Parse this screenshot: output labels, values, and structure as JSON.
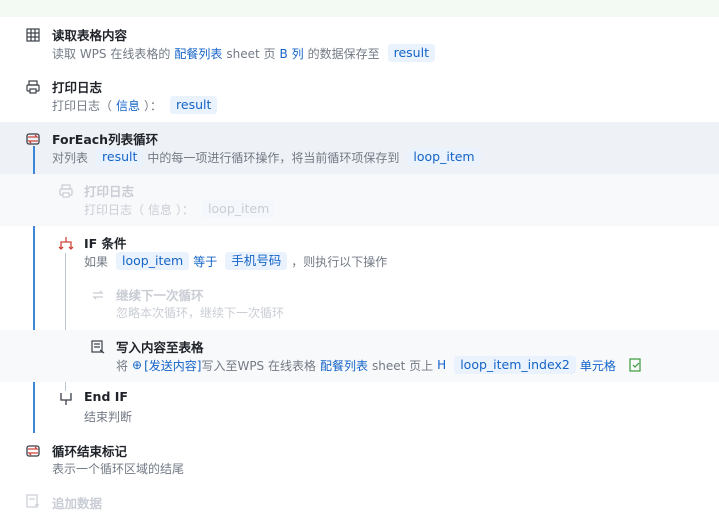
{
  "steps": [
    {
      "title": "读取表格内容",
      "desc": [
        "读取 WPS 在线表格的",
        "配餐列表",
        "sheet 页",
        "B 列",
        "的数据保存至",
        "result"
      ]
    },
    {
      "title": "打印日志",
      "desc": [
        "打印日志（",
        "信息",
        "）：",
        "result"
      ]
    },
    {
      "title": "ForEach列表循环",
      "desc": [
        "对列表",
        "result",
        "中的每一项进行循环操作，将当前循环项保存到",
        "loop_item"
      ]
    },
    {
      "title": "打印日志",
      "desc": [
        "打印日志（",
        "信息",
        "）：",
        "loop_item"
      ]
    },
    {
      "title": "IF 条件",
      "desc": [
        "如果",
        "loop_item",
        "等于",
        "手机号码",
        "，则执行以下操作"
      ]
    },
    {
      "title": "继续下一次循环",
      "desc": [
        "忽略本次循环，继续下一次循环"
      ]
    },
    {
      "title": "写入内容至表格",
      "desc": [
        "将",
        "[发送内容]",
        "写入至WPS 在线表格",
        "配餐列表",
        "sheet 页上",
        "H",
        "loop_item_index2",
        "单元格"
      ]
    },
    {
      "title": "End IF",
      "desc": [
        "结束判断"
      ]
    },
    {
      "title": "循环结束标记",
      "desc": [
        "表示一个循环区域的结尾"
      ]
    },
    {
      "title": "追加数据",
      "desc": []
    }
  ],
  "icons": [
    "table-icon",
    "printer-icon",
    "loop-icon",
    "printer-icon",
    "branch-icon",
    "loop-icon",
    "write-table-icon",
    "end-branch-icon",
    "loop-end-icon",
    "append-icon",
    "edit-note-icon",
    "variable-icon"
  ],
  "colors": {
    "accent": "#1464c8",
    "tag_bg": "#eaf3fd",
    "highlight": "#eef1f6",
    "line": "#3d86d6"
  }
}
